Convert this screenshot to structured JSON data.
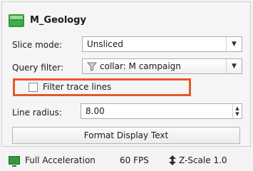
{
  "panel": {
    "title": "M_Geology",
    "slice_mode": {
      "label": "Slice mode:",
      "value": "Unsliced"
    },
    "query_filter": {
      "label": "Query filter:",
      "value": "collar: M campaign"
    },
    "filter_trace_lines": {
      "label": "Filter trace lines",
      "checked": false
    },
    "line_radius": {
      "label": "Line radius:",
      "value": "8.00"
    },
    "format_button": "Format Display Text"
  },
  "status_bar": {
    "acceleration": "Full Acceleration",
    "fps": "60 FPS",
    "z_scale": "Z-Scale 1.0"
  },
  "colors": {
    "highlight": "#e8572a",
    "geology_icon": "#2e9a3c"
  },
  "icons": [
    "geology-layer-icon",
    "filter-funnel-icon",
    "chevron-down-icon",
    "spin-arrows-icon",
    "display-icon",
    "z-scale-icon"
  ]
}
